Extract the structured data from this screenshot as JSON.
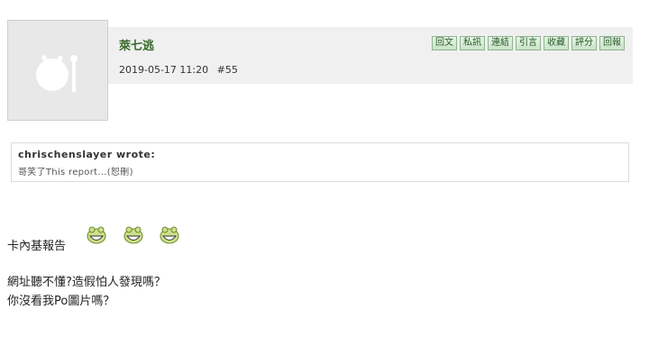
{
  "post": {
    "author": "萊七逃",
    "date": "2019-05-17 11:20",
    "floor": "#55"
  },
  "actions": [
    {
      "label": "回文"
    },
    {
      "label": "私訊"
    },
    {
      "label": "連結"
    },
    {
      "label": "引言"
    },
    {
      "label": "收藏"
    },
    {
      "label": "評分"
    },
    {
      "label": "回報"
    }
  ],
  "quote": {
    "author": "chrischenslayer wrote:",
    "text": "哥笑了This report...(恕刪)"
  },
  "content": {
    "line1": "卡內基報告",
    "line2": "網址聽不懂?造假怕人發現嗎？",
    "line3": "你沒看我Po圖片嗎？"
  },
  "emoticons": [
    "laughing-face-icon",
    "laughing-face-icon",
    "laughing-face-icon"
  ],
  "colors": {
    "header_bg": "#f0f0f0",
    "author": "#3a6b2a",
    "button_border": "#8fb48f",
    "button_bg": "#c9e2c9"
  }
}
